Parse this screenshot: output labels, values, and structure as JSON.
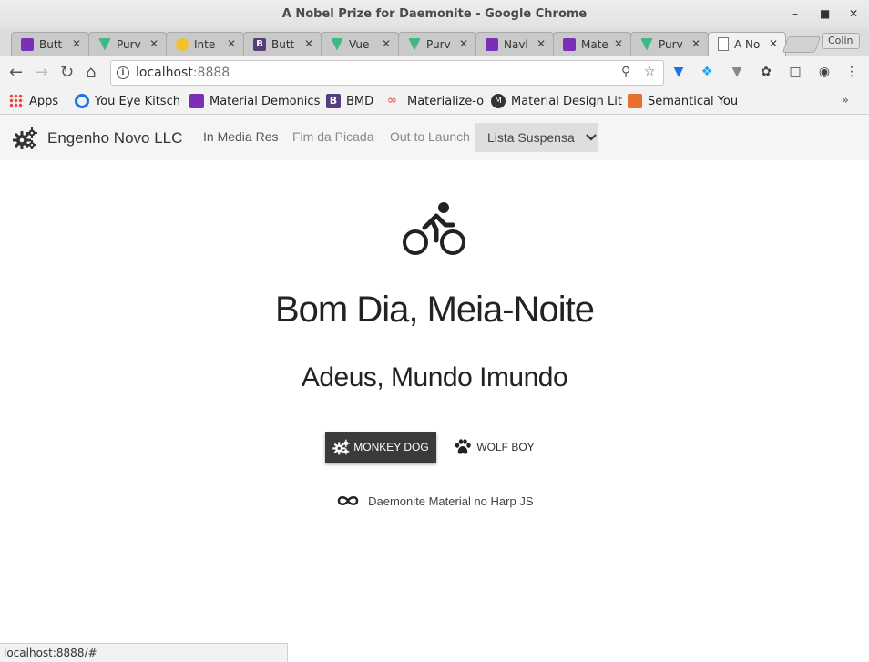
{
  "window": {
    "title": "A Nobel Prize for Daemonite - Google Chrome",
    "profile": "Colin"
  },
  "tabs": [
    {
      "label": "Butt",
      "icon": "materialize-icon",
      "color": "#7b2fb6"
    },
    {
      "label": "Purv",
      "icon": "vue-icon",
      "color": "#41b883"
    },
    {
      "label": "Inte",
      "icon": "python-icon",
      "color": "#f2c12e"
    },
    {
      "label": "Butt",
      "icon": "bootstrap-icon",
      "color": "#563d7c"
    },
    {
      "label": "Vue",
      "icon": "vue-icon",
      "color": "#41b883"
    },
    {
      "label": "Purv",
      "icon": "vue-icon",
      "color": "#41b883"
    },
    {
      "label": "Navl",
      "icon": "materialize-icon",
      "color": "#7b2fb6"
    },
    {
      "label": "Mate",
      "icon": "materialize-icon",
      "color": "#7b2fb6"
    },
    {
      "label": "Purv",
      "icon": "vue-icon",
      "color": "#41b883"
    },
    {
      "label": "A No",
      "icon": "page-icon",
      "color": "#ffffff"
    }
  ],
  "address": {
    "host": "localhost",
    "port": ":8888"
  },
  "bookmarks": [
    {
      "label": "Apps"
    },
    {
      "label": "You Eye Kitsch"
    },
    {
      "label": "Material Demonics"
    },
    {
      "label": "BMD"
    },
    {
      "label": "Materialize-o"
    },
    {
      "label": "Material Design Lit"
    },
    {
      "label": "Semantical You"
    }
  ],
  "navbar": {
    "brand": "Engenho Novo LLC",
    "links": [
      "In Media Res",
      "Fim da Picada",
      "Out to Launch"
    ],
    "dropdown": "Lista Suspensa"
  },
  "hero": {
    "title": "Bom Dia, Meia-Noite",
    "subtitle": "Adeus, Mundo Imundo",
    "primary_button": "MONKEY DOG",
    "secondary_button": "WOLF BOY",
    "footer": "Daemonite Material no Harp JS"
  },
  "status_bar": "localhost:8888/#"
}
